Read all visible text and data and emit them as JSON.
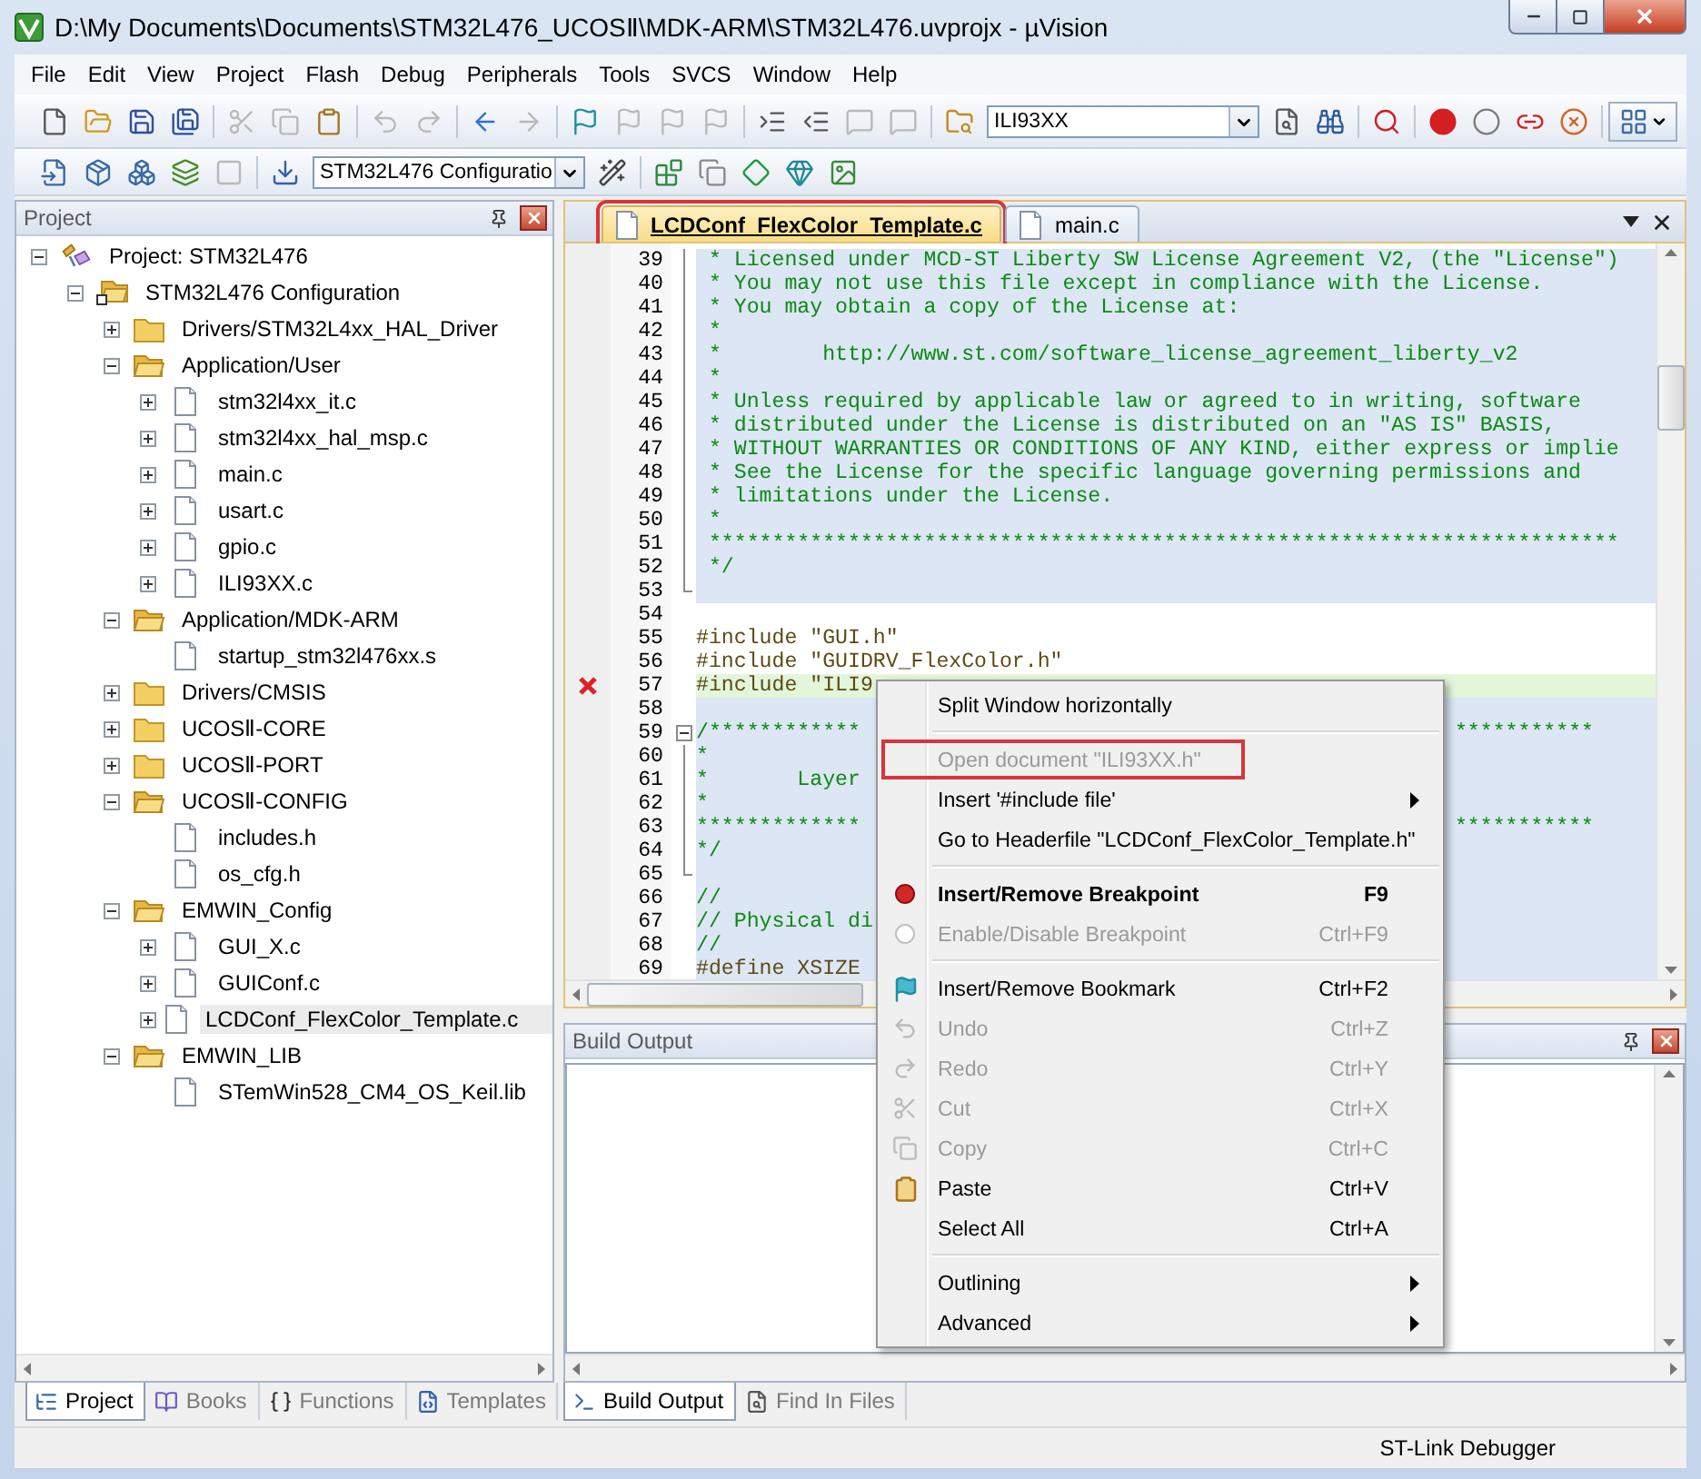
{
  "window": {
    "title": "D:\\My Documents\\Documents\\STM32L476_UCOSⅡ\\MDK-ARM\\STM32L476.uvprojx - µVision"
  },
  "menu_bar": [
    "File",
    "Edit",
    "View",
    "Project",
    "Flash",
    "Debug",
    "Peripherals",
    "Tools",
    "SVCS",
    "Window",
    "Help"
  ],
  "toolbar_1": [
    {
      "kind": "new",
      "disabled": false
    },
    {
      "kind": "open",
      "disabled": false
    },
    {
      "kind": "save",
      "disabled": false
    },
    {
      "kind": "save-all",
      "disabled": false
    },
    {
      "kind": "separator"
    },
    {
      "kind": "cut",
      "disabled": true
    },
    {
      "kind": "copy",
      "disabled": true
    },
    {
      "kind": "paste",
      "disabled": false
    },
    {
      "kind": "separator"
    },
    {
      "kind": "undo",
      "disabled": true
    },
    {
      "kind": "redo",
      "disabled": true
    },
    {
      "kind": "separator"
    },
    {
      "kind": "back",
      "disabled": false
    },
    {
      "kind": "forward",
      "disabled": true
    },
    {
      "kind": "separator"
    },
    {
      "kind": "bookmark",
      "disabled": false
    },
    {
      "kind": "bookmark-prev",
      "disabled": true
    },
    {
      "kind": "bookmark-next",
      "disabled": true
    },
    {
      "kind": "bookmark-clear",
      "disabled": true
    },
    {
      "kind": "separator"
    },
    {
      "kind": "indent",
      "disabled": false
    },
    {
      "kind": "outdent",
      "disabled": false
    },
    {
      "kind": "comment",
      "disabled": true
    },
    {
      "kind": "uncomment",
      "disabled": true
    },
    {
      "kind": "separator"
    },
    {
      "kind": "find-in-files",
      "disabled": false
    },
    {
      "kind": "combo",
      "value": "ILI93XX"
    },
    {
      "kind": "find",
      "disabled": false
    },
    {
      "kind": "incremental-find",
      "disabled": false
    },
    {
      "kind": "separator"
    },
    {
      "kind": "debug",
      "disabled": false
    },
    {
      "kind": "separator"
    },
    {
      "kind": "breakpoint",
      "disabled": false
    },
    {
      "kind": "breakpoint-off",
      "disabled": false
    },
    {
      "kind": "breakpoint-kill",
      "disabled": false
    },
    {
      "kind": "breakpoint-clear",
      "disabled": false
    },
    {
      "kind": "separator"
    },
    {
      "kind": "windows",
      "disabled": false
    }
  ],
  "toolbar_2": [
    {
      "kind": "translate",
      "disabled": false
    },
    {
      "kind": "build",
      "disabled": false
    },
    {
      "kind": "rebuild",
      "disabled": false
    },
    {
      "kind": "batch-build",
      "disabled": false
    },
    {
      "kind": "stop",
      "disabled": true
    },
    {
      "kind": "separator"
    },
    {
      "kind": "download",
      "disabled": false
    },
    {
      "kind": "combo",
      "value": "STM32L476 Configuratio"
    },
    {
      "kind": "options",
      "disabled": false
    },
    {
      "kind": "separator"
    },
    {
      "kind": "manage-rte",
      "disabled": false
    },
    {
      "kind": "select-packs",
      "disabled": false
    },
    {
      "kind": "pack-installer",
      "disabled": false
    },
    {
      "kind": "pack-green",
      "disabled": false
    },
    {
      "kind": "rte-image",
      "disabled": false
    }
  ],
  "project_panel": {
    "title": "Project",
    "tree": [
      {
        "label": "Project: STM32L476",
        "kind": "project",
        "expanded": true,
        "selected": false,
        "children": [
          {
            "label": "STM32L476 Configuration",
            "kind": "target",
            "expanded": true,
            "selected": false,
            "children": [
              {
                "label": "Drivers/STM32L4xx_HAL_Driver",
                "kind": "folder",
                "expanded": false,
                "selected": false
              },
              {
                "label": "Application/User",
                "kind": "folder",
                "expanded": true,
                "selected": false,
                "children": [
                  {
                    "label": "stm32l4xx_it.c",
                    "kind": "file",
                    "expanded": false,
                    "selected": false
                  },
                  {
                    "label": "stm32l4xx_hal_msp.c",
                    "kind": "file",
                    "expanded": false,
                    "selected": false
                  },
                  {
                    "label": "main.c",
                    "kind": "file",
                    "expanded": false,
                    "selected": false
                  },
                  {
                    "label": "usart.c",
                    "kind": "file",
                    "expanded": false,
                    "selected": false
                  },
                  {
                    "label": "gpio.c",
                    "kind": "file",
                    "expanded": false,
                    "selected": false
                  },
                  {
                    "label": "ILI93XX.c",
                    "kind": "file",
                    "expanded": false,
                    "selected": false
                  }
                ]
              },
              {
                "label": "Application/MDK-ARM",
                "kind": "folder",
                "expanded": true,
                "selected": false,
                "children": [
                  {
                    "label": "startup_stm32l476xx.s",
                    "kind": "file",
                    "selected": false
                  }
                ]
              },
              {
                "label": "Drivers/CMSIS",
                "kind": "folder",
                "expanded": false,
                "selected": false
              },
              {
                "label": "UCOSⅡ-CORE",
                "kind": "folder",
                "expanded": false,
                "selected": false
              },
              {
                "label": "UCOSⅡ-PORT",
                "kind": "folder",
                "expanded": false,
                "selected": false
              },
              {
                "label": "UCOSⅡ-CONFIG",
                "kind": "folder",
                "expanded": true,
                "selected": false,
                "children": [
                  {
                    "label": "includes.h",
                    "kind": "file",
                    "selected": false
                  },
                  {
                    "label": "os_cfg.h",
                    "kind": "file",
                    "selected": false
                  }
                ]
              },
              {
                "label": "EMWIN_Config",
                "kind": "folder",
                "expanded": true,
                "selected": false,
                "children": [
                  {
                    "label": "GUI_X.c",
                    "kind": "file",
                    "expanded": false,
                    "selected": false
                  },
                  {
                    "label": "GUIConf.c",
                    "kind": "file",
                    "expanded": false,
                    "selected": false
                  },
                  {
                    "label": "LCDConf_FlexColor_Template.c",
                    "kind": "file",
                    "expanded": false,
                    "selected": true
                  }
                ]
              },
              {
                "label": "EMWIN_LIB",
                "kind": "folder",
                "expanded": true,
                "selected": false,
                "children": [
                  {
                    "label": "STemWin528_CM4_OS_Keil.lib",
                    "kind": "file",
                    "selected": false
                  }
                ]
              }
            ]
          }
        ]
      }
    ],
    "tabs": [
      {
        "label": "Project",
        "kind": "project",
        "selected": true
      },
      {
        "label": "Books",
        "kind": "books",
        "selected": false
      },
      {
        "label": "Functions",
        "kind": "functions",
        "selected": false
      },
      {
        "label": "Templates",
        "kind": "templates",
        "selected": false
      }
    ]
  },
  "editor": {
    "tabs": [
      {
        "label": "LCDConf_FlexColor_Template.c",
        "selected": true,
        "outlined": true
      },
      {
        "label": "main.c",
        "selected": false,
        "outlined": false
      }
    ],
    "lines": [
      {
        "number": "39",
        "kind": "comment",
        "shaded": true,
        "in_fold": true,
        "text": " * Licensed under MCD-ST Liberty SW License Agreement V2, (the \"License\")"
      },
      {
        "number": "40",
        "kind": "comment",
        "shaded": true,
        "in_fold": true,
        "text": " * You may not use this file except in compliance with the License."
      },
      {
        "number": "41",
        "kind": "comment",
        "shaded": true,
        "in_fold": true,
        "text": " * You may obtain a copy of the License at:"
      },
      {
        "number": "42",
        "kind": "comment",
        "shaded": true,
        "in_fold": true,
        "text": " *"
      },
      {
        "number": "43",
        "kind": "comment",
        "shaded": true,
        "in_fold": true,
        "text": " *        http://www.st.com/software_license_agreement_liberty_v2"
      },
      {
        "number": "44",
        "kind": "comment",
        "shaded": true,
        "in_fold": true,
        "text": " *"
      },
      {
        "number": "45",
        "kind": "comment",
        "shaded": true,
        "in_fold": true,
        "text": " * Unless required by applicable law or agreed to in writing, software"
      },
      {
        "number": "46",
        "kind": "comment",
        "shaded": true,
        "in_fold": true,
        "text": " * distributed under the License is distributed on an \"AS IS\" BASIS,"
      },
      {
        "number": "47",
        "kind": "comment",
        "shaded": true,
        "in_fold": true,
        "text": " * WITHOUT WARRANTIES OR CONDITIONS OF ANY KIND, either express or implie"
      },
      {
        "number": "48",
        "kind": "comment",
        "shaded": true,
        "in_fold": true,
        "text": " * See the License for the specific language governing permissions and"
      },
      {
        "number": "49",
        "kind": "comment",
        "shaded": true,
        "in_fold": true,
        "text": " * limitations under the License."
      },
      {
        "number": "50",
        "kind": "comment",
        "shaded": true,
        "in_fold": true,
        "text": " *"
      },
      {
        "number": "51",
        "kind": "comment",
        "shaded": true,
        "in_fold": true,
        "text": " ************************************************************************"
      },
      {
        "number": "52",
        "kind": "comment",
        "shaded": true,
        "in_fold": true,
        "text": " */"
      },
      {
        "number": "53",
        "kind": "comment",
        "shaded": true,
        "fold_end": true
      },
      {
        "number": "54",
        "kind": "code",
        "shaded": false
      },
      {
        "number": "55",
        "kind": "code",
        "shaded": false,
        "text": "#include \"GUI.h\""
      },
      {
        "number": "56",
        "kind": "code",
        "shaded": false,
        "text": "#include \"GUIDRV_FlexColor.h\""
      },
      {
        "number": "57",
        "kind": "current",
        "shaded": false,
        "error": true,
        "text": "#include \"ILI9"
      },
      {
        "number": "58",
        "kind": "comment",
        "shaded": true
      },
      {
        "number": "59",
        "kind": "comment",
        "shaded": true,
        "fold_toggle": true,
        "text": "/************",
        "text_right": "***********"
      },
      {
        "number": "60",
        "kind": "comment",
        "shaded": true,
        "in_fold": true,
        "text": "*"
      },
      {
        "number": "61",
        "kind": "comment",
        "shaded": true,
        "in_fold": true,
        "text": "*       Layer"
      },
      {
        "number": "62",
        "kind": "comment",
        "shaded": true,
        "in_fold": true,
        "text": "*"
      },
      {
        "number": "63",
        "kind": "comment",
        "shaded": true,
        "in_fold": true,
        "text": "*************",
        "text_right": "***********"
      },
      {
        "number": "64",
        "kind": "comment",
        "shaded": true,
        "in_fold": true,
        "text": "*/"
      },
      {
        "number": "65",
        "kind": "comment",
        "shaded": true,
        "fold_end": true
      },
      {
        "number": "66",
        "kind": "comment",
        "shaded": true,
        "text": "//"
      },
      {
        "number": "67",
        "kind": "comment",
        "shaded": true,
        "text": "// Physical di"
      },
      {
        "number": "68",
        "kind": "comment",
        "shaded": true,
        "text": "//"
      },
      {
        "number": "69",
        "kind": "code",
        "shaded": true,
        "text": "#define XSIZE"
      }
    ]
  },
  "build_output": {
    "title": "Build Output",
    "tabs": [
      {
        "label": "Build Output",
        "kind": "build",
        "selected": true
      },
      {
        "label": "Find In Files",
        "kind": "find",
        "selected": false
      }
    ]
  },
  "context_menu": [
    {
      "kind": "plain",
      "label": "Split Window horizontally",
      "disabled": false,
      "default": false,
      "submenu": false,
      "outlined": false
    },
    {
      "kind": "separator"
    },
    {
      "kind": "plain",
      "label": "Open document \"ILI93XX.h\"",
      "disabled": true,
      "default": false,
      "submenu": false,
      "outlined": true
    },
    {
      "kind": "plain",
      "label": "Insert '#include file'",
      "disabled": false,
      "default": false,
      "submenu": true,
      "outlined": false
    },
    {
      "kind": "plain",
      "label": "Go to Headerfile \"LCDConf_FlexColor_Template.h\"",
      "disabled": false,
      "default": false,
      "submenu": false,
      "outlined": false
    },
    {
      "kind": "separator"
    },
    {
      "kind": "breakpoint",
      "label": "Insert/Remove Breakpoint",
      "shortcut": "F9",
      "disabled": false,
      "default": true,
      "submenu": false,
      "outlined": false
    },
    {
      "kind": "breakpoint-toggle",
      "label": "Enable/Disable Breakpoint",
      "shortcut": "Ctrl+F9",
      "disabled": true,
      "default": false,
      "submenu": false,
      "outlined": false
    },
    {
      "kind": "separator"
    },
    {
      "kind": "bookmark",
      "label": "Insert/Remove Bookmark",
      "shortcut": "Ctrl+F2",
      "disabled": false,
      "default": false,
      "submenu": false,
      "outlined": false
    },
    {
      "kind": "undo",
      "label": "Undo",
      "shortcut": "Ctrl+Z",
      "disabled": true,
      "default": false,
      "submenu": false,
      "outlined": false
    },
    {
      "kind": "redo",
      "label": "Redo",
      "shortcut": "Ctrl+Y",
      "disabled": true,
      "default": false,
      "submenu": false,
      "outlined": false
    },
    {
      "kind": "cut",
      "label": "Cut",
      "shortcut": "Ctrl+X",
      "disabled": true,
      "default": false,
      "submenu": false,
      "outlined": false
    },
    {
      "kind": "copy",
      "label": "Copy",
      "shortcut": "Ctrl+C",
      "disabled": true,
      "default": false,
      "submenu": false,
      "outlined": false
    },
    {
      "kind": "paste",
      "label": "Paste",
      "shortcut": "Ctrl+V",
      "disabled": false,
      "default": false,
      "submenu": false,
      "outlined": false
    },
    {
      "kind": "plain",
      "label": "Select All",
      "shortcut": "Ctrl+A",
      "disabled": false,
      "default": false,
      "submenu": false,
      "outlined": false
    },
    {
      "kind": "separator"
    },
    {
      "kind": "plain",
      "label": "Outlining",
      "disabled": false,
      "default": false,
      "submenu": true,
      "outlined": false
    },
    {
      "kind": "plain",
      "label": "Advanced",
      "disabled": false,
      "default": false,
      "submenu": true,
      "outlined": false
    }
  ],
  "status_bar": {
    "debugger": "ST-Link Debugger"
  }
}
